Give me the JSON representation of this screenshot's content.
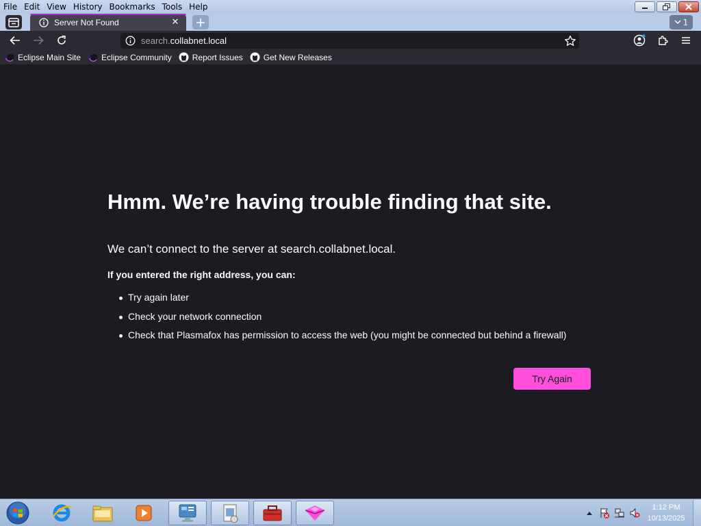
{
  "menu": [
    "File",
    "Edit",
    "View",
    "History",
    "Bookmarks",
    "Tools",
    "Help"
  ],
  "tab": {
    "title": "Server Not Found"
  },
  "tab_count": "1",
  "url": {
    "prefix": "search.",
    "domain": "collabnet.local"
  },
  "bookmarks": [
    {
      "label": "Eclipse Main Site",
      "icon": "eclipse-icon"
    },
    {
      "label": "Eclipse Community",
      "icon": "eclipse-icon"
    },
    {
      "label": "Report Issues",
      "icon": "github-icon"
    },
    {
      "label": "Get New Releases",
      "icon": "github-icon"
    }
  ],
  "error": {
    "title": "Hmm. We’re having trouble finding that site.",
    "description": "We can’t connect to the server at search.collabnet.local.",
    "subtitle": "If you entered the right address, you can:",
    "items": [
      "Try again later",
      "Check your network connection",
      "Check that Plasmafox has permission to access the web (you might be connected but behind a firewall)"
    ],
    "button": "Try Again"
  },
  "clock": {
    "time": "1:12 PM",
    "date": "10/13/2025"
  },
  "colors": {
    "accent": "#ff4fdc",
    "background": "#1c1b22",
    "toolbar": "#2b2a33"
  }
}
